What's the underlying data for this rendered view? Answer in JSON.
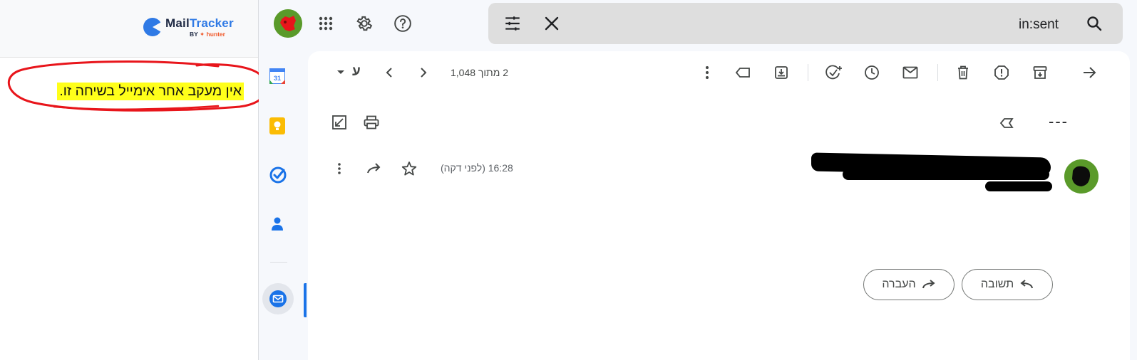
{
  "mailtracker": {
    "brand_part1": "Mail",
    "brand_part2": "Tracker",
    "by_label": "BY",
    "hunter_label": "hunter",
    "message": "אין מעקב אחר אימייל בשיחה זו."
  },
  "topbar": {
    "search_query": "in:sent",
    "icons": [
      "avatar",
      "apps-icon",
      "settings-icon",
      "help-icon",
      "search-options-icon",
      "clear-search-icon",
      "search-icon"
    ]
  },
  "rail": {
    "calendar_day": "31",
    "icons": [
      "calendar-icon",
      "keep-icon",
      "tasks-icon",
      "contacts-icon",
      "mailtracker-icon"
    ]
  },
  "toolbar": {
    "pager": "2 מתוך 1,048",
    "input_tool": "ע"
  },
  "message": {
    "subject": "---",
    "time": "16:28 (לפני דקה)"
  },
  "actions": {
    "reply_label": "תשובה",
    "forward_label": "העברה"
  },
  "colors": {
    "highlight": "#ffff1a",
    "annotation": "#e8151b",
    "accent": "#1a73e8",
    "avatar_green": "#5a9a2a",
    "brand_blue": "#2f7ae5",
    "hunter_orange": "#f0592a"
  }
}
